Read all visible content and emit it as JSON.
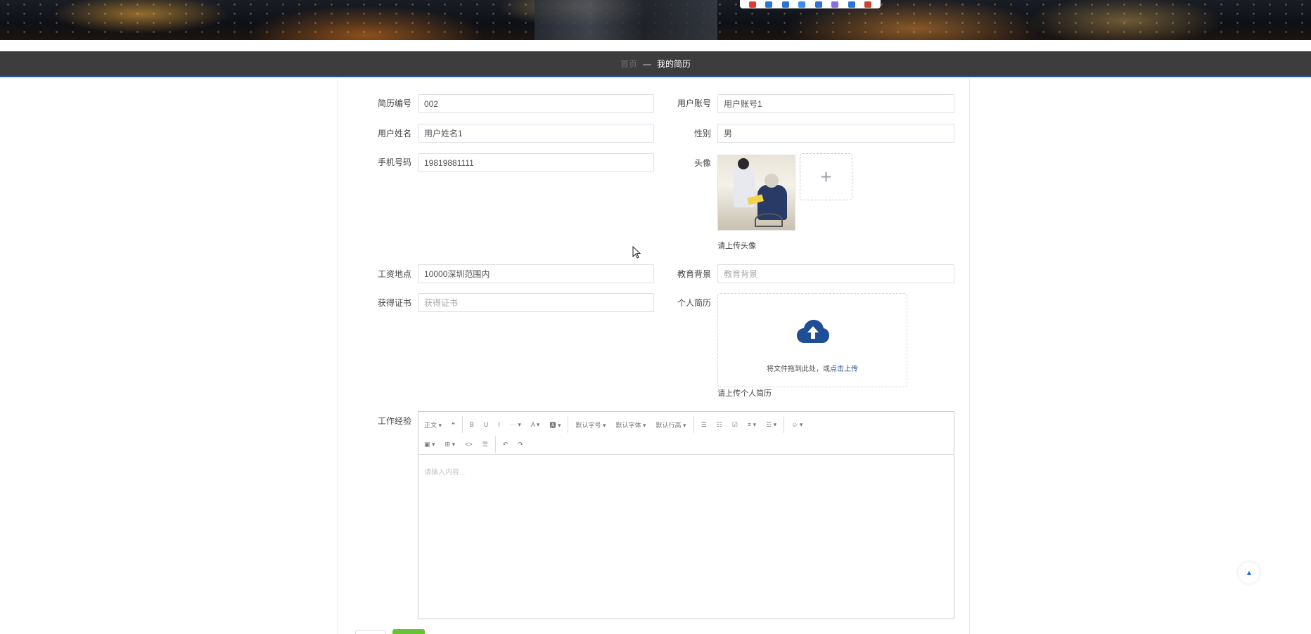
{
  "nav": {
    "home": "首页",
    "separator": "—",
    "current": "我的简历"
  },
  "form": {
    "resume_no": {
      "label": "简历编号",
      "value": "002",
      "placeholder": ""
    },
    "user_account": {
      "label": "用户账号",
      "value": "用户账号1",
      "placeholder": ""
    },
    "user_name": {
      "label": "用户姓名",
      "value": "用户姓名1",
      "placeholder": ""
    },
    "gender": {
      "label": "性别",
      "value": "男",
      "placeholder": ""
    },
    "phone": {
      "label": "手机号码",
      "value": "19819881111",
      "placeholder": ""
    },
    "avatar": {
      "label": "头像",
      "hint": "请上传头像",
      "add_symbol": "+"
    },
    "salary_location": {
      "label": "工资地点",
      "value": "10000深圳范围内",
      "placeholder": ""
    },
    "education": {
      "label": "教育背景",
      "value": "",
      "placeholder": "教育背景"
    },
    "certificates": {
      "label": "获得证书",
      "value": "",
      "placeholder": "获得证书"
    },
    "resume_file": {
      "label": "个人简历",
      "drop_text": "将文件拖到此处，或",
      "drop_link": "点击上传",
      "hint": "请上传个人简历"
    },
    "work_experience": {
      "label": "工作经验",
      "placeholder": "请输入内容...",
      "toolbar_row1": [
        "正文 ▾",
        "❝",
        "B",
        "U",
        "I",
        "··· ▾",
        "A ▾",
        "🅰 ▾",
        "默认字号 ▾",
        "默认字体 ▾",
        "默认行高 ▾",
        "☰",
        "☷",
        "☑",
        "≡ ▾",
        "☲ ▾",
        "☺ ▾"
      ],
      "toolbar_row2": [
        "▣ ▾",
        "⊞ ▾",
        "<>",
        "☰",
        "↶",
        "↷"
      ]
    }
  },
  "scroll_top_icon": "▲",
  "colors": {
    "nav_bg": "#3d3d3d",
    "accent_blue": "#1f4e96",
    "button_green": "#67c23a"
  }
}
